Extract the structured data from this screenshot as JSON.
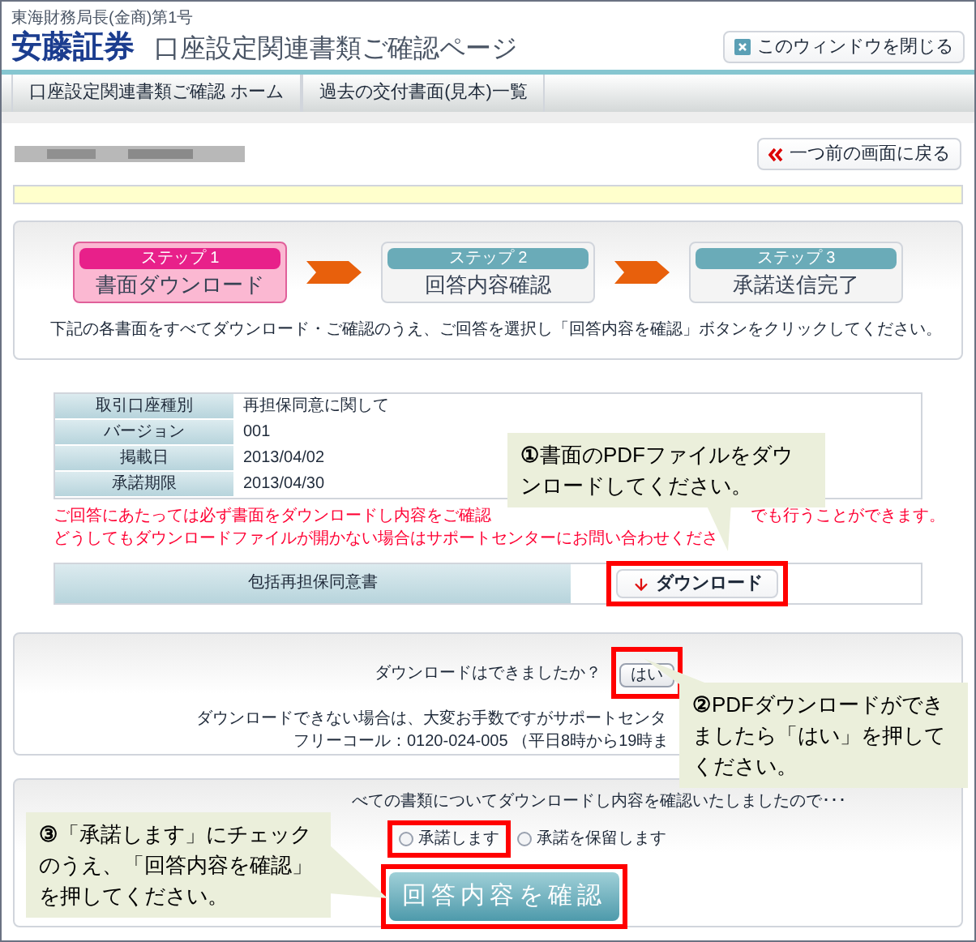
{
  "header": {
    "registration": "東海財務局長(金商)第1号",
    "logo": "安藤証券",
    "title": "口座設定関連書類ご確認ページ",
    "close_button": "このウィンドウを閉じる"
  },
  "nav": [
    "口座設定関連書類ご確認 ホーム",
    "過去の交付書面(見本)一覧"
  ],
  "back_button": "一つ前の画面に戻る",
  "steps": [
    {
      "label": "ステップ 1",
      "name": "書面ダウンロード",
      "selected": true
    },
    {
      "label": "ステップ 2",
      "name": "回答内容確認",
      "selected": false
    },
    {
      "label": "ステップ 3",
      "name": "承諾送信完了",
      "selected": false
    }
  ],
  "instruction": "下記の各書面をすべてダウンロード・ご確認のうえ、ご回答を選択し「回答内容を確認」ボタンをクリックしてください。",
  "info_table": [
    {
      "label": "取引口座種別",
      "value": "再担保同意に関して"
    },
    {
      "label": "バージョン",
      "value": "001"
    },
    {
      "label": "掲載日",
      "value": "2013/04/02"
    },
    {
      "label": "承諾期限",
      "value": "2013/04/30"
    }
  ],
  "notice_lines": [
    [
      "ご回答にあたっては必ず書面をダウンロードし内容をご確認",
      "でも行うことができます。"
    ],
    [
      "どうしてもダウンロードファイルが開かない場合はサポートセンターにお問い合わせくださ"
    ]
  ],
  "documents": [
    {
      "name": "包括再担保同意書",
      "button": "ダウンロード"
    }
  ],
  "download_check": {
    "question": "ダウンロードはできましたか？",
    "yes_button": "はい",
    "help_lines": [
      "ダウンロードできない場合は、大変お手数ですがサポートセンタ",
      "フリーコール：0120-024-005 （平日8時から19時ま"
    ]
  },
  "consent": {
    "prompt": "べての書類についてダウンロードし内容を確認いたしましたので･･･",
    "options": [
      {
        "label": "承諾します",
        "selected": false
      },
      {
        "label": "承諾を保留します",
        "selected": false
      }
    ],
    "confirm_button": "回答内容を確認"
  },
  "callouts": [
    {
      "number": "①",
      "text": "書面のPDFファイルをダウンロードしてください。"
    },
    {
      "number": "②",
      "text": "PDFダウンロードができましたら「はい」を押してください。"
    },
    {
      "number": "③",
      "text": "「承諾します」にチェックのうえ、「回答内容を確認」を押してください。"
    }
  ]
}
